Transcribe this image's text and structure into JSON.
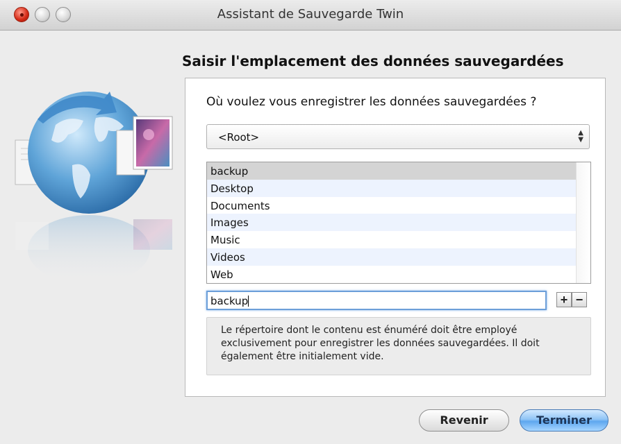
{
  "window": {
    "title": "Assistant de Sauvegarde Twin"
  },
  "page": {
    "heading": "Saisir l'emplacement des données sauvegardées"
  },
  "form": {
    "question": "Où voulez vous enregistrer les données sauvegardées ?",
    "location_select": {
      "selected": "<Root>"
    },
    "folders": [
      "backup",
      "Desktop",
      "Documents",
      "Images",
      "Music",
      "Videos",
      "Web"
    ],
    "selected_folder": "backup",
    "name_field": {
      "value": "backup"
    },
    "add_label": "+",
    "remove_label": "−",
    "info": "Le répertoire dont le contenu est énuméré doit être employé exclusivement pour enregistrer les données sauvegardées. Il doit également être initialement vide."
  },
  "buttons": {
    "back": "Revenir",
    "finish": "Terminer"
  },
  "colors": {
    "accent": "#5ea7ef",
    "close": "#d42814",
    "row_alt": "#edf3fe",
    "row_selected": "#d4d4d4"
  }
}
